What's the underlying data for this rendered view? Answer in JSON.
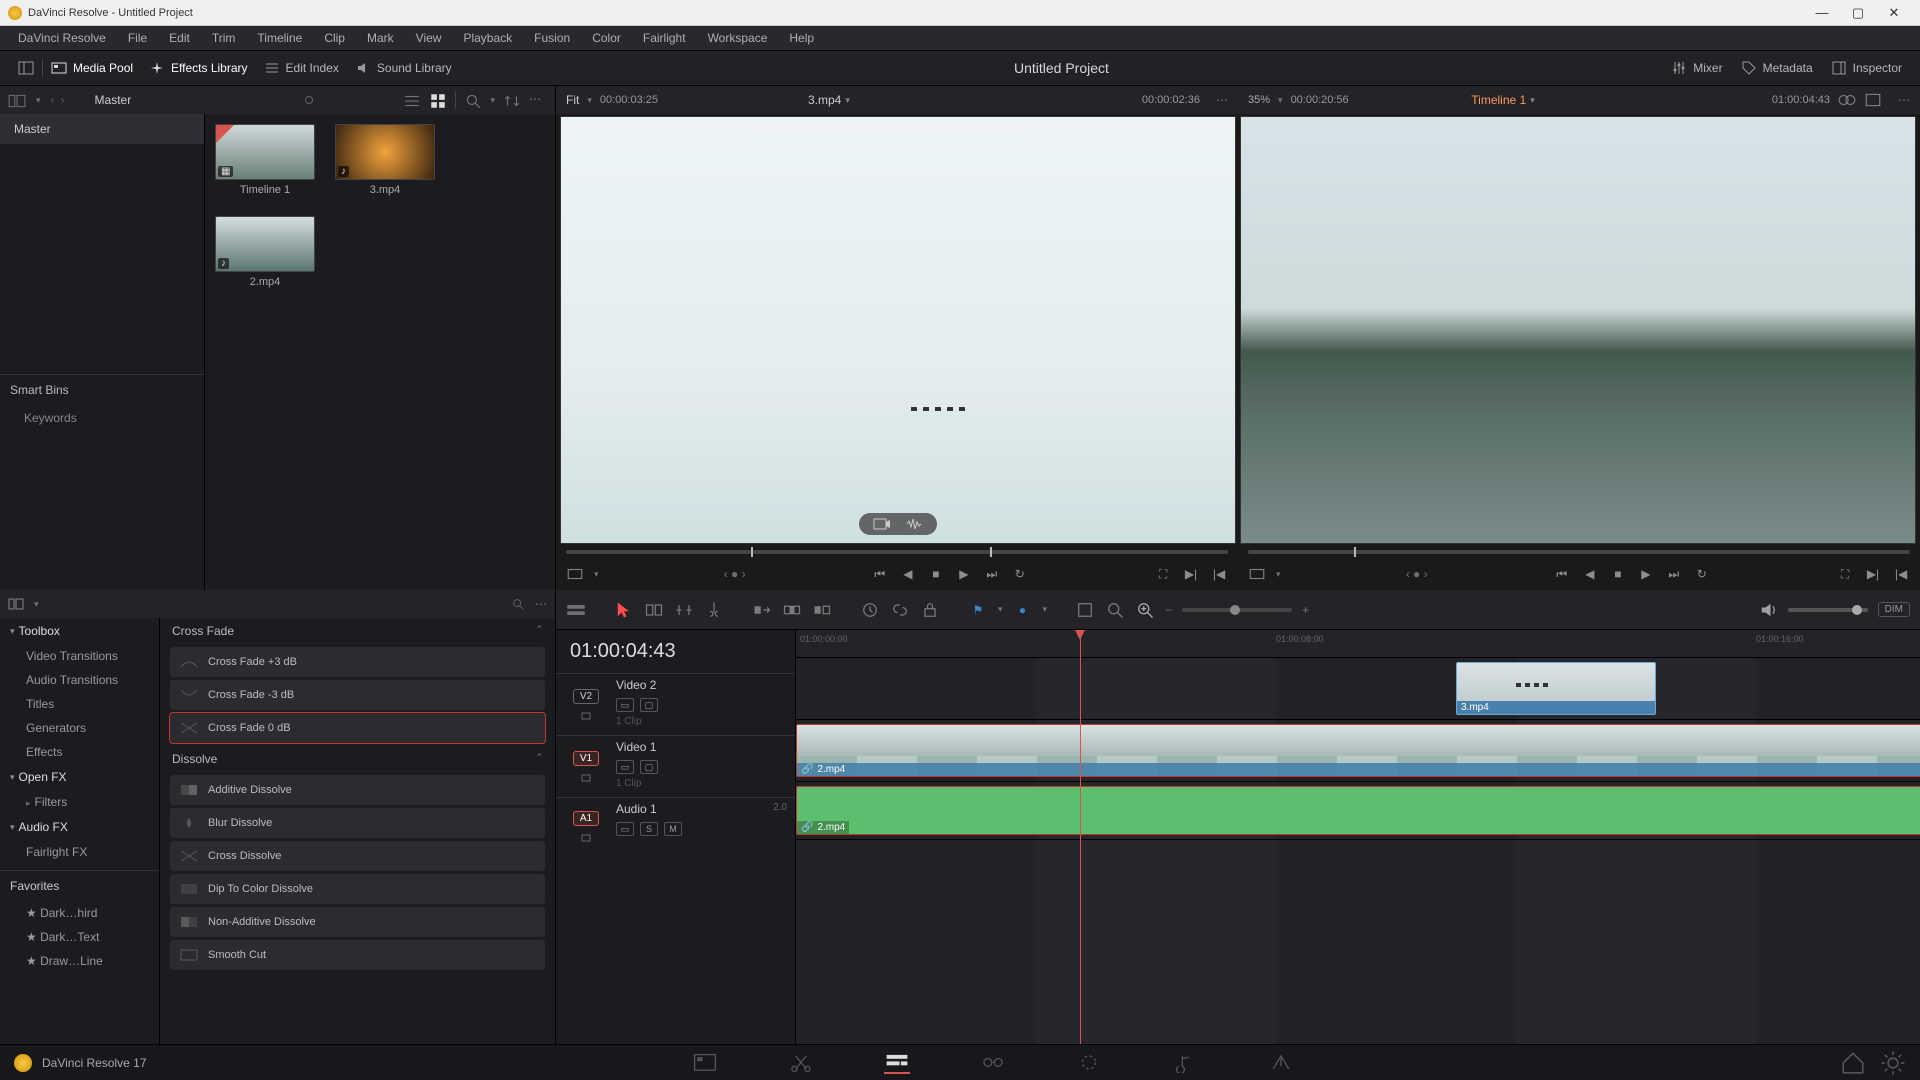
{
  "titlebar": {
    "text": "DaVinci Resolve - Untitled Project"
  },
  "menu": [
    "DaVinci Resolve",
    "File",
    "Edit",
    "Trim",
    "Timeline",
    "Clip",
    "Mark",
    "View",
    "Playback",
    "Fusion",
    "Color",
    "Fairlight",
    "Workspace",
    "Help"
  ],
  "topbar": {
    "media_pool": "Media Pool",
    "effects_library": "Effects Library",
    "edit_index": "Edit Index",
    "sound_library": "Sound Library",
    "mixer": "Mixer",
    "metadata": "Metadata",
    "inspector": "Inspector",
    "project_title": "Untitled Project"
  },
  "media": {
    "breadcrumb": "Master",
    "tree_root": "Master",
    "smart_bins": "Smart Bins",
    "keywords": "Keywords",
    "clips": [
      {
        "name": "Timeline 1",
        "kind": "timeline"
      },
      {
        "name": "3.mp4",
        "kind": "av"
      },
      {
        "name": "2.mp4",
        "kind": "av"
      }
    ]
  },
  "source_viewer": {
    "fit": "Fit",
    "tc_left": "00:00:03:25",
    "clip_name": "3.mp4",
    "tc_right": "00:00:02:36"
  },
  "timeline_viewer": {
    "zoom": "35%",
    "tc_left": "00:00:20:56",
    "timeline_name": "Timeline 1",
    "tc_right": "01:00:04:43"
  },
  "fx": {
    "toolbox": "Toolbox",
    "cats": [
      "Video Transitions",
      "Audio Transitions",
      "Titles",
      "Generators",
      "Effects"
    ],
    "openfx": "Open FX",
    "filters": "Filters",
    "audiofx": "Audio FX",
    "fairlightfx": "Fairlight FX",
    "favorites": "Favorites",
    "fav_items": [
      "Dark…hird",
      "Dark…Text",
      "Draw…Line"
    ],
    "group_crossfade": "Cross Fade",
    "crossfades": [
      "Cross Fade +3 dB",
      "Cross Fade -3 dB",
      "Cross Fade 0 dB"
    ],
    "group_dissolve": "Dissolve",
    "dissolves": [
      "Additive Dissolve",
      "Blur Dissolve",
      "Cross Dissolve",
      "Dip To Color Dissolve",
      "Non-Additive Dissolve",
      "Smooth Cut"
    ]
  },
  "timeline": {
    "tc": "01:00:04:43",
    "ruler": [
      "01:00:00:00",
      "01:00:08:00",
      "01:00:16:00"
    ],
    "v2": {
      "tag": "V2",
      "name": "Video 2",
      "clips_sub": "1 Clip",
      "clip_label": "3.mp4"
    },
    "v1": {
      "tag": "V1",
      "name": "Video 1",
      "clips_sub": "1 Clip",
      "clip_label": "2.mp4"
    },
    "a1": {
      "tag": "A1",
      "name": "Audio 1",
      "ch": "2.0",
      "clip_label": "2.mp4"
    },
    "dim": "DIM"
  },
  "footer": {
    "app": "DaVinci Resolve 17"
  }
}
